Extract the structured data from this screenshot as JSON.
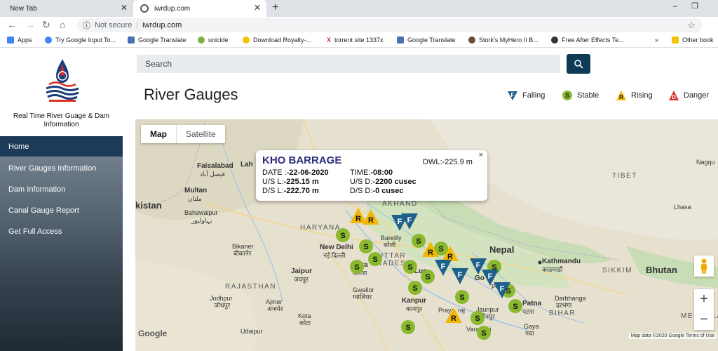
{
  "browser": {
    "tabs": [
      {
        "label": "New Tab"
      },
      {
        "label": "iwrdup.com"
      }
    ],
    "address": {
      "security": "Not secure",
      "url": "iwrdup.com"
    },
    "bookmarks": [
      {
        "label": "Apps",
        "color": "#4285f4"
      },
      {
        "label": "Try Google Input To...",
        "color": "#4285f4"
      },
      {
        "label": "Google Translate",
        "color": "#4a6fb5"
      },
      {
        "label": "unicide",
        "color": "#7cb342"
      },
      {
        "label": "Download Royalty-...",
        "color": "#f4c20d"
      },
      {
        "label": "torrent site 1337x",
        "color": "#d32f2f"
      },
      {
        "label": "Google Translate",
        "color": "#4a6fb5"
      },
      {
        "label": "Stork's MyHero II B...",
        "color": "#6d4c41"
      },
      {
        "label": "Free After Effects Te...",
        "color": "#333333"
      },
      {
        "label": "Other book",
        "color": "#f4c20d"
      }
    ]
  },
  "sidebar": {
    "site_title": "Real Time River Guage & Dam Information",
    "items": [
      {
        "label": "Home",
        "active": true
      },
      {
        "label": "River Gauges Information",
        "active": false
      },
      {
        "label": "Dam Information",
        "active": false
      },
      {
        "label": "Canal Gauge Report",
        "active": false
      },
      {
        "label": "Get Full Access",
        "active": false
      }
    ]
  },
  "search": {
    "placeholder": "Search"
  },
  "page": {
    "title": "River Gauges"
  },
  "legend": [
    {
      "label": "Falling",
      "letter": "F",
      "color": "#1f5f8b"
    },
    {
      "label": "Stable",
      "letter": "S",
      "color": "#8ab82e"
    },
    {
      "label": "Rising",
      "letter": "R",
      "color": "#f2b705"
    },
    {
      "label": "Danger",
      "letter": "D",
      "color": "#d9342b"
    }
  ],
  "map": {
    "type_buttons": {
      "map": "Map",
      "satellite": "Satellite"
    },
    "labels": {
      "faisalabad": "Faisalabad",
      "faisalabad_ur": "فیصل آباد",
      "lahore": "Lah",
      "multan": "Multan",
      "multan_ur": "ملتان",
      "pakistan": "kistan",
      "bahawalpur": "Bahawalpur",
      "bahawalpur_ur": "بہاولپور",
      "haryana": "HARYANA",
      "uttarakhand": "AKHAND",
      "bikaner": "Bikaner",
      "bikaner_hi": "बीकानेर",
      "newdelhi": "New Delhi",
      "newdelhi_hi": "नई दिल्ली",
      "agra": "gra",
      "agra_hi": "आगरा",
      "bareilly": "Bareilly",
      "bareilly_hi": "बरेली",
      "uttar": "UTTAR",
      "pradesh": "PRADESH",
      "jaipur": "Jaipur",
      "jaipur_hi": "जयपुर",
      "rajasthan": "RAJASTHAN",
      "gwalior": "Gwalior",
      "gwalior_hi": "ग्वालियर",
      "lucknow": "Luc",
      "kanpur": "Kanpur",
      "kanpur_hi": "कानपुर",
      "jodhpur": "Jodhpur",
      "jodhpur_hi": "जोधपुर",
      "ajmer": "Ajmer",
      "ajmer_hi": "अजमेर",
      "kota": "Kota",
      "kota_hi": "कोटा",
      "udaipur": "Udaipur",
      "prayagraj": "Praya",
      "prayagraj2": "raj",
      "jaunpur": "Jaunpur",
      "jaunpur_hi": "जौनपुर",
      "varanasi": "Vara",
      "varanasi2": "asi",
      "gorakhpur": "Go",
      "gorakhpur2": "pur",
      "nepal": "Nepal",
      "kathmandu": "Kathmandu",
      "kathmandu_np": "काठमाडौं",
      "tibet": "TIBET",
      "nagqu": "Nagqu",
      "lhasa": "Lhasa",
      "sikkim": "SIKKIM",
      "bhutan": "Bhutan",
      "patna": "Patna",
      "patna_hi": "पटना",
      "darbhanga": "Darbhanga",
      "darbhanga_hi": "दरभंगा",
      "bihar": "BIHAR",
      "gaya": "Gaya",
      "gaya_hi": "गया",
      "meghalaya": "MEGHALA"
    },
    "popup": {
      "title": "KHO BARRAGE",
      "dwl_label": "DWL:",
      "dwl": "-225.9 m",
      "date_label": "DATE :",
      "date": "-22-06-2020",
      "time_label": "TIME:",
      "time": "-08:00",
      "us_level_label": "U/S L:",
      "us_level": "-225.15 m",
      "us_discharge_label": "U/S D:",
      "us_discharge": "-2200 cusec",
      "ds_level_label": "D/S L:",
      "ds_level": "-222.70 m",
      "ds_discharge_label": "D/S D:",
      "ds_discharge": "-0 cusec",
      "close": "×"
    },
    "zoom_in": "+",
    "zoom_out": "−",
    "google": "Google",
    "attribution": "Map data ©2020 Google   Terms of Use"
  }
}
